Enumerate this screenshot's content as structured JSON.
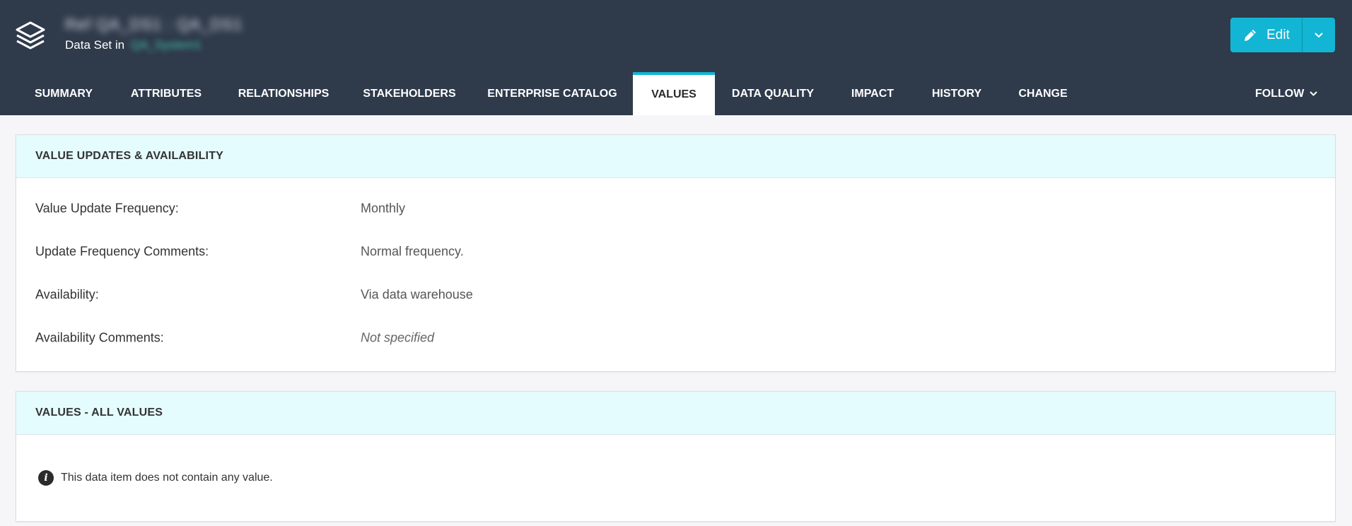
{
  "header": {
    "asset_title": "Ref QA_DS1 : QA_DS1",
    "subtitle_prefix": "Data Set in",
    "subtitle_link": "QA_System1",
    "edit_label": "Edit"
  },
  "tabs": [
    {
      "label": "SUMMARY"
    },
    {
      "label": "ATTRIBUTES"
    },
    {
      "label": "RELATIONSHIPS"
    },
    {
      "label": "STAKEHOLDERS"
    },
    {
      "label": "ENTERPRISE CATALOG"
    },
    {
      "label": "VALUES"
    },
    {
      "label": "DATA QUALITY"
    },
    {
      "label": "IMPACT"
    },
    {
      "label": "HISTORY"
    },
    {
      "label": "CHANGE"
    }
  ],
  "active_tab": "VALUES",
  "follow_label": "FOLLOW",
  "panel_updates": {
    "title": "VALUE UPDATES & AVAILABILITY",
    "rows": [
      {
        "label": "Value Update Frequency:",
        "value": "Monthly"
      },
      {
        "label": "Update Frequency Comments:",
        "value": "Normal frequency."
      },
      {
        "label": "Availability:",
        "value": "Via data warehouse"
      },
      {
        "label": "Availability Comments:",
        "value": "Not specified"
      }
    ]
  },
  "panel_values": {
    "title": "VALUES - ALL VALUES",
    "info_text": "This data item does not contain any value."
  },
  "colors": {
    "topbar": "#2f3a4b",
    "accent": "#12b5d4",
    "panel_header": "#e4fcfd"
  },
  "icons": {
    "logo": "layers-icon",
    "edit": "pencil-icon",
    "dropdown": "chevron-down-icon",
    "info": "info-circle-icon"
  }
}
